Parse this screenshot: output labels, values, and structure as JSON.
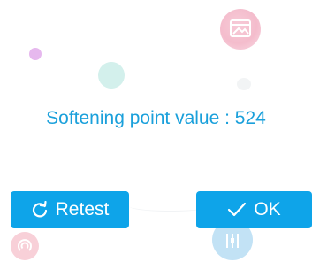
{
  "dialog": {
    "message": "Softening point value : 524",
    "buttons": {
      "retest_label": "Retest",
      "ok_label": "OK"
    },
    "icons": {
      "retest": "refresh-icon",
      "ok": "checkmark-icon"
    }
  },
  "colors": {
    "accent": "#0ea4e9",
    "message_text": "#1aa0db",
    "background": "#ffffff"
  }
}
